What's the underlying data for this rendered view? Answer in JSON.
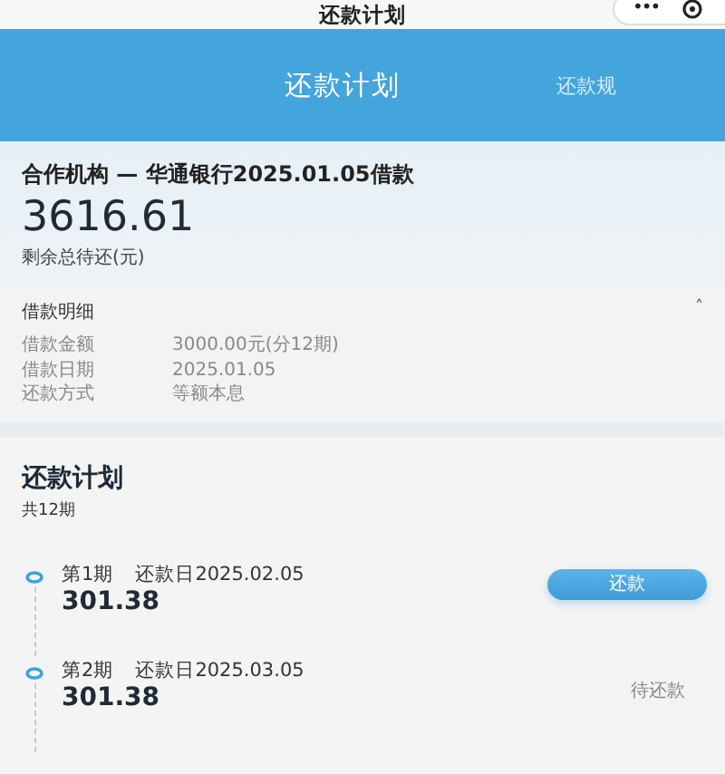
{
  "window": {
    "title": "还款计划",
    "menu": "•••"
  },
  "tabs": [
    {
      "label": "还款计划",
      "selected": true
    },
    {
      "label": "还款规",
      "selected": false
    }
  ],
  "loan": {
    "title": "合作机构 — 华通银行2025.01.05借款",
    "amount": "3616.61",
    "amount_label": "剩余总待还(元)"
  },
  "details": {
    "title": "借款明细",
    "expanded": true,
    "toggle": "˄",
    "rows": [
      {
        "label": "借款金额",
        "value": "3000.00元(分12期)"
      },
      {
        "label": "借款日期",
        "value": "2025.01.05"
      },
      {
        "label": "还款方式",
        "value": "等额本息"
      }
    ]
  },
  "plan": {
    "title": "还款计划",
    "count": "共12期",
    "items": [
      {
        "period": "第1期",
        "due": "还款日2025.02.05",
        "amount": "301.38",
        "kind": "button",
        "action": "还款"
      },
      {
        "period": "第2期",
        "due": "还款日2025.03.05",
        "amount": "301.38",
        "kind": "status",
        "action": "待还款"
      }
    ]
  }
}
